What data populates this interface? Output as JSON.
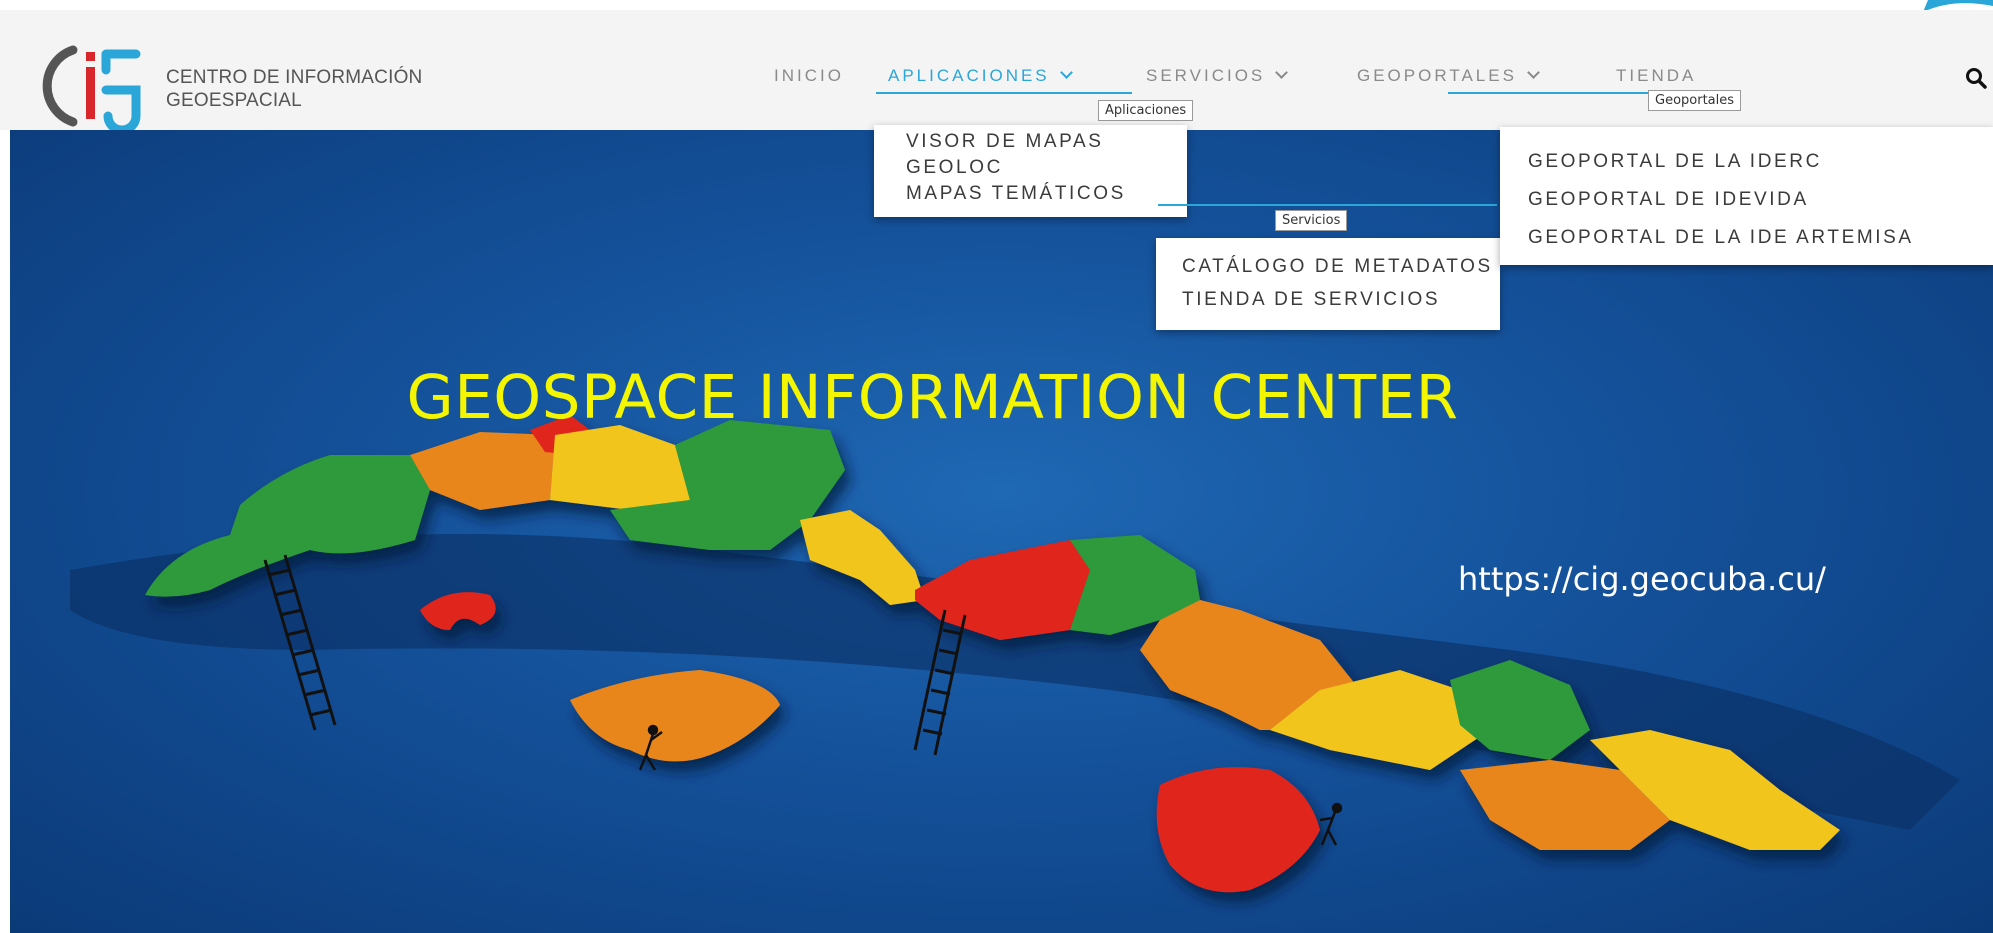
{
  "header": {
    "logo_line1": "CENTRO DE INFORMACIÓN",
    "logo_line2": "GEOESPACIAL",
    "nav": [
      {
        "label": "INICIO"
      },
      {
        "label": "APLICACIONES"
      },
      {
        "label": "SERVICIOS"
      },
      {
        "label": "GEOPORTALES"
      },
      {
        "label": "TIENDA"
      }
    ],
    "search_icon": "search-icon"
  },
  "menus": {
    "aplicaciones": {
      "tab": "Aplicaciones",
      "items": [
        "VISOR DE MAPAS",
        "GEOLOC",
        "MAPAS TEMÁTICOS"
      ]
    },
    "servicios": {
      "tab": "Servicios",
      "items": [
        "CATÁLOGO DE METADATOS",
        "TIENDA DE SERVICIOS"
      ]
    },
    "geoportales": {
      "tab": "Geoportales",
      "items": [
        "GEOPORTAL DE LA IDERC",
        "GEOPORTAL DE IDEVIDA",
        "GEOPORTAL DE LA IDE ARTEMISA"
      ]
    }
  },
  "hero": {
    "title": "GEOSPACE INFORMATION CENTER",
    "url": "https://cig.geocuba.cu/"
  },
  "colors": {
    "accent": "#2aa6d9",
    "title": "#f3f600",
    "green": "#2e9a3a",
    "orange": "#e8861c",
    "yellow": "#f2c51a",
    "red": "#e0251c"
  }
}
